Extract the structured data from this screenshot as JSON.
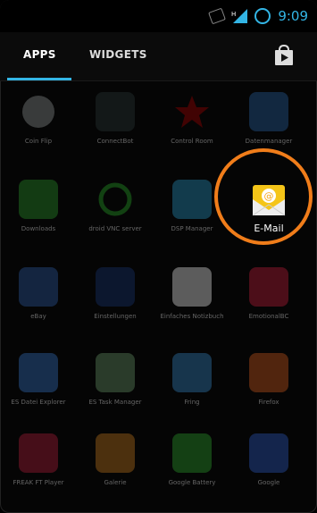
{
  "status_bar": {
    "time": "9:09",
    "signal_label": "H",
    "accent_color": "#33b5e5"
  },
  "tabs": [
    {
      "label": "APPS",
      "selected": true
    },
    {
      "label": "WIDGETS",
      "selected": false
    }
  ],
  "apps": [
    {
      "label": "Coin Flip",
      "icon": "coin-icon",
      "color": "#9aa0a0",
      "dimmed": true
    },
    {
      "label": "ConnectBot",
      "icon": "terminal-icon",
      "color": "#2d3d3d",
      "dimmed": true
    },
    {
      "label": "Control Room",
      "icon": "star-icon",
      "color": "#b00000",
      "dimmed": true
    },
    {
      "label": "Datenmanager",
      "icon": "camera-icon",
      "color": "#2b6bb0",
      "dimmed": true
    },
    {
      "label": "Downloads",
      "icon": "download-icon",
      "color": "#2ea02e",
      "dimmed": true
    },
    {
      "label": "droid VNC server",
      "icon": "ring-icon",
      "color": "#2ab02a",
      "dimmed": true
    },
    {
      "label": "DSP Manager",
      "icon": "equalizer-icon",
      "color": "#2aa0d0",
      "dimmed": true
    },
    {
      "label": "E-Mail",
      "icon": "email-icon",
      "color": "#f5c518",
      "dimmed": false
    },
    {
      "label": "eBay",
      "icon": "ebay-icon",
      "color": "#3060b0",
      "dimmed": true
    },
    {
      "label": "Einstellungen",
      "icon": "blue-square-icon",
      "color": "#1a3a7a",
      "dimmed": true
    },
    {
      "label": "Einfaches Notizbuch",
      "icon": "pen-icon",
      "color": "#ffffff",
      "dimmed": true
    },
    {
      "label": "EmotionalBC",
      "icon": "dot-icon",
      "color": "#d02040",
      "dimmed": true
    },
    {
      "label": "ES Datei Explorer",
      "icon": "cloud-icon",
      "color": "#3a7ad0",
      "dimmed": true
    },
    {
      "label": "ES Task Manager",
      "icon": "gauge-icon",
      "color": "#6fa06f",
      "dimmed": true
    },
    {
      "label": "Fring",
      "icon": "dots-icon",
      "color": "#3a90d0",
      "dimmed": true
    },
    {
      "label": "Firefox",
      "icon": "firefox-icon",
      "color": "#e06020",
      "dimmed": true
    },
    {
      "label": "FREAK FT Player",
      "icon": "play-icon",
      "color": "#c02040",
      "dimmed": true
    },
    {
      "label": "Galerie",
      "icon": "gallery-icon",
      "color": "#d08020",
      "dimmed": true
    },
    {
      "label": "Google Battery",
      "icon": "tree-icon",
      "color": "#30b030",
      "dimmed": true
    },
    {
      "label": "Google",
      "icon": "google-icon",
      "color": "#3060d0",
      "dimmed": true
    }
  ],
  "highlight_color": "#f07d1a"
}
